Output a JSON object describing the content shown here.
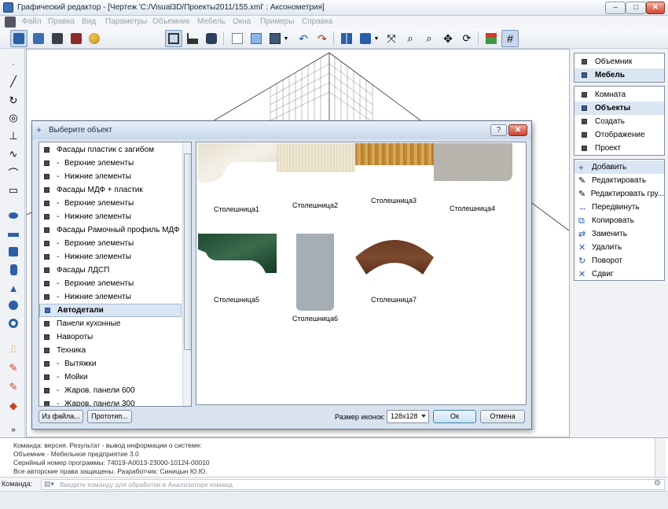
{
  "window": {
    "title": "Графический редактор - [Чертеж 'C:/Visual3D/Проекты2011/155.xml' : Аксонометрия]",
    "minimize": "–",
    "maximize": "□",
    "close": "✕"
  },
  "menu": [
    "Файл",
    "Правка",
    "Вид",
    "Параметры",
    "Объемник",
    "Мебель",
    "Окна",
    "Примеры",
    "Справка"
  ],
  "right_panel": {
    "mode_group": [
      {
        "label": "Объемник",
        "selected": false
      },
      {
        "label": "Мебель",
        "selected": true
      }
    ],
    "section_group": [
      {
        "label": "Комната",
        "selected": false
      },
      {
        "label": "Объекты",
        "selected": true
      },
      {
        "label": "Создать",
        "selected": false
      },
      {
        "label": "Отображение",
        "selected": false
      },
      {
        "label": "Проект",
        "selected": false
      }
    ],
    "actions": [
      {
        "label": "Добавить",
        "icon": "plus-icon",
        "selected": true
      },
      {
        "label": "Редактировать",
        "icon": "edit-icon",
        "selected": false
      },
      {
        "label": "Редактировать гру...",
        "icon": "edit-group-icon",
        "selected": false
      },
      {
        "label": "Передвинуть",
        "icon": "move-icon",
        "selected": false
      },
      {
        "label": "Копировать",
        "icon": "copy-icon",
        "selected": false
      },
      {
        "label": "Заменить",
        "icon": "replace-icon",
        "selected": false
      },
      {
        "label": "Удалить",
        "icon": "delete-icon",
        "selected": false
      },
      {
        "label": "Поворот",
        "icon": "rotate-icon",
        "selected": false
      },
      {
        "label": "Сдвиг",
        "icon": "shift-icon",
        "selected": false
      }
    ]
  },
  "dialog": {
    "title": "Выберите объект",
    "help": "?",
    "close": "✕",
    "tree": [
      {
        "label": "Фасады пластик с загибом",
        "child": false,
        "selected": false
      },
      {
        "label": "Верхние элементы",
        "child": true,
        "selected": false
      },
      {
        "label": "Нижние элементы",
        "child": true,
        "selected": false
      },
      {
        "label": "Фасады МДФ + пластик",
        "child": false,
        "selected": false
      },
      {
        "label": "Верхние элементы",
        "child": true,
        "selected": false
      },
      {
        "label": "Нижние элементы",
        "child": true,
        "selected": false
      },
      {
        "label": "Фасады Рамочный профиль МДФ",
        "child": false,
        "selected": false
      },
      {
        "label": "Верхние элементы",
        "child": true,
        "selected": false
      },
      {
        "label": "Нижние элементы",
        "child": true,
        "selected": false
      },
      {
        "label": "Фасады ЛДСП",
        "child": false,
        "selected": false
      },
      {
        "label": "Верхние элементы",
        "child": true,
        "selected": false
      },
      {
        "label": "Нижние элементы",
        "child": true,
        "selected": false
      },
      {
        "label": "Автодетали",
        "child": false,
        "selected": true
      },
      {
        "label": "Панели кухонные",
        "child": false,
        "selected": false
      },
      {
        "label": "Навороты",
        "child": false,
        "selected": false
      },
      {
        "label": "Техника",
        "child": false,
        "selected": false
      },
      {
        "label": "Вытяжки",
        "child": true,
        "selected": false
      },
      {
        "label": "Мойки",
        "child": true,
        "selected": false
      },
      {
        "label": "Жаров. панели 600",
        "child": true,
        "selected": false
      },
      {
        "label": "Жаров. панели 300",
        "child": true,
        "selected": false
      }
    ],
    "items": [
      {
        "label": "Столешница1",
        "material": "marble-white"
      },
      {
        "label": "Столешница2",
        "material": "beige-linen"
      },
      {
        "label": "Столешница3",
        "material": "oak"
      },
      {
        "label": "Столешница4",
        "material": "grey-granite"
      },
      {
        "label": "Столешница5",
        "material": "green-marble"
      },
      {
        "label": "Столешница6",
        "material": "grey-plastic"
      },
      {
        "label": "Столешница7",
        "material": "dark-wood"
      }
    ],
    "from_file": "Из файла...",
    "prototype": "Прототип...",
    "icon_size_label": "Размер иконок:",
    "icon_size_value": "128x128",
    "ok": "Ок",
    "cancel": "Отмена"
  },
  "console": {
    "lines": [
      "Команда: версия. Результат - вывод информации о системе:",
      "Объемник - Мебельное предприятие 3.0",
      "Серийный номер программы: 74019-A0013-23000-10124-00010",
      "Все авторские права защищены. Разработчик: Синицын Ю.Ю."
    ]
  },
  "command": {
    "label": "Команда:",
    "placeholder": "Введите команду для обработки в Анализаторе команд"
  }
}
